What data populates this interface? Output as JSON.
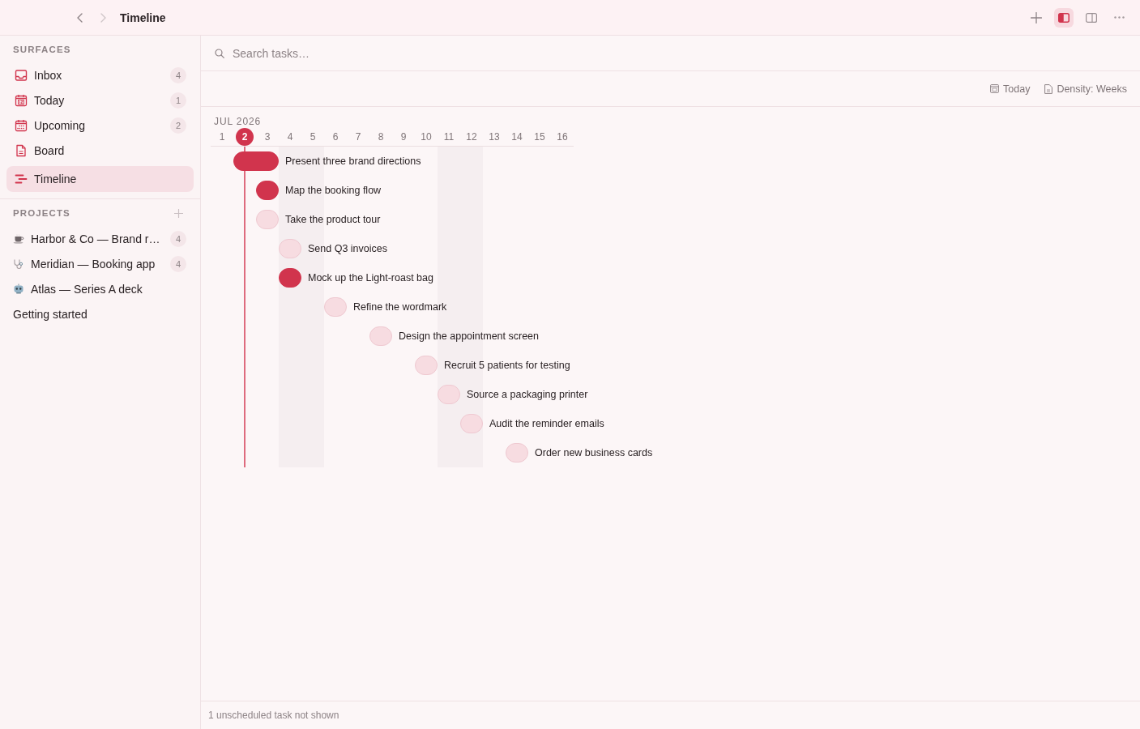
{
  "window": {
    "title": "Timeline",
    "nav_buttons": [
      {
        "disabled": false
      },
      {
        "disabled": true
      }
    ],
    "panel_toggles": [
      {
        "selected": true
      },
      {
        "selected": false
      }
    ]
  },
  "sidebar": {
    "surfaces_heading": "SURFACES",
    "surfaces": [
      {
        "label": "Inbox",
        "count": "4",
        "selected": false
      },
      {
        "label": "Today",
        "count": "1",
        "selected": false
      },
      {
        "label": "Upcoming",
        "count": "2",
        "selected": false
      },
      {
        "label": "Board",
        "selected": false
      },
      {
        "label": "Timeline",
        "selected": true
      }
    ],
    "projects_heading": "PROJECTS",
    "projects": [
      {
        "label": "Harbor & Co — Brand r…",
        "count": "4",
        "selected": false
      },
      {
        "label": "Meridian — Booking app",
        "count": "4",
        "selected": false
      },
      {
        "label": "Atlas — Series A deck",
        "selected": false
      }
    ],
    "footer_link": "Getting started"
  },
  "search": {
    "placeholder": "Search tasks…"
  },
  "toolbar": {
    "buttons": [
      "Today",
      "Density: Weeks"
    ]
  },
  "timeline": {
    "month": "JUL 2026",
    "days": [
      {
        "label": "1",
        "today": false,
        "weekend": false
      },
      {
        "label": "2",
        "today": true,
        "weekend": false,
        "tasks": [
          {
            "title": "Present three brand directions",
            "kind": "double",
            "color": "#d1344d"
          }
        ]
      },
      {
        "label": "3",
        "today": false,
        "weekend": false,
        "tasks": [
          {
            "title": "Map the booking flow",
            "kind": "single",
            "color": "#d1344d"
          },
          {
            "title": "Take the product tour",
            "kind": "single",
            "color": "#f7dce1"
          }
        ]
      },
      {
        "label": "4",
        "today": false,
        "weekend": true,
        "tasks": [
          {
            "title": "Send Q3 invoices",
            "kind": "single",
            "color": "#f7dce1"
          },
          {
            "title": "Mock up the Light-roast bag",
            "kind": "single",
            "color": "#d1344d"
          }
        ]
      },
      {
        "label": "5",
        "today": false,
        "weekend": true
      },
      {
        "label": "6",
        "today": false,
        "weekend": false,
        "tasks": [
          {
            "title": "Refine the wordmark",
            "kind": "single",
            "color": "#f7dce1"
          }
        ]
      },
      {
        "label": "7",
        "today": false,
        "weekend": false
      },
      {
        "label": "8",
        "today": false,
        "weekend": false,
        "tasks": [
          {
            "title": "Design the appointment screen",
            "kind": "single",
            "color": "#f7dce1"
          }
        ]
      },
      {
        "label": "9",
        "today": false,
        "weekend": false
      },
      {
        "label": "10",
        "today": false,
        "weekend": false,
        "tasks": [
          {
            "title": "Recruit 5 patients for testing",
            "kind": "single",
            "color": "#f7dce1"
          }
        ]
      },
      {
        "label": "11",
        "today": false,
        "weekend": true,
        "tasks": [
          {
            "title": "Source a packaging printer",
            "kind": "single",
            "color": "#f7dce1"
          }
        ]
      },
      {
        "label": "12",
        "today": false,
        "weekend": true,
        "tasks": [
          {
            "title": "Audit the reminder emails",
            "kind": "single",
            "color": "#f7dce1"
          }
        ]
      },
      {
        "label": "13",
        "today": false,
        "weekend": false
      },
      {
        "label": "14",
        "today": false,
        "weekend": false,
        "tasks": [
          {
            "title": "Order new business cards",
            "kind": "single",
            "color": "#f7dce1"
          }
        ]
      },
      {
        "label": "15",
        "today": false,
        "weekend": false
      },
      {
        "label": "16",
        "today": false,
        "weekend": false
      }
    ]
  },
  "status_bar": "1 unscheduled task not shown"
}
